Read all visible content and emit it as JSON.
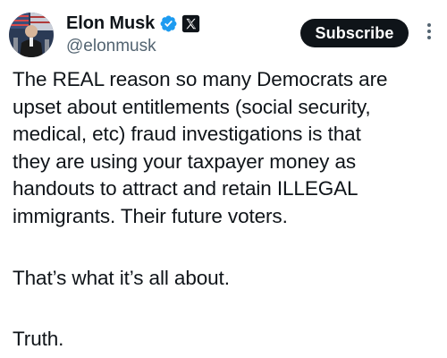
{
  "author": {
    "display_name": "Elon Musk",
    "handle": "@elonmusk",
    "avatar_icon": "avatar-photo",
    "verified_icon": "verified-badge-icon",
    "affiliate_icon": "x-logo-icon"
  },
  "actions": {
    "subscribe_label": "Subscribe",
    "more_icon": "more-vertical-icon"
  },
  "tweet": {
    "paragraphs": [
      "The REAL reason so many Democrats are\nupset about entitlements (social security,\nmedical, etc) fraud investigations is that\nthey are using your taxpayer money as\nhandouts to attract and retain ILLEGAL\nimmigrants. Their future voters.",
      "That’s what it’s all about.",
      "Truth."
    ]
  },
  "colors": {
    "text": "#0f1419",
    "secondary_text": "#536471",
    "verified_blue": "#1d9bf0",
    "button_bg": "#0f1419",
    "button_text": "#ffffff"
  }
}
